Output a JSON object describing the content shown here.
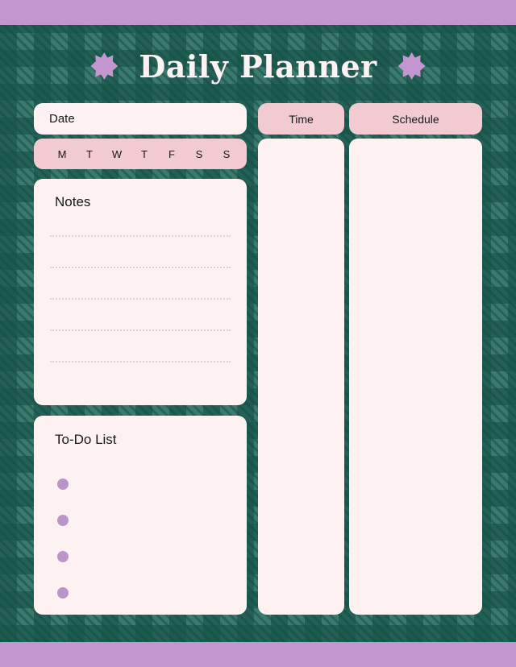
{
  "theme": {
    "accent_purple": "#c396cf",
    "plaid_green": "#3c7a6e",
    "plaid_green_dark": "#236155",
    "card_cream": "#fdf1f2",
    "pink": "#f2cbd2",
    "bullet_purple": "#bb95c9",
    "dotted_line": "#e9cdd3"
  },
  "header": {
    "title": "Daily Planner",
    "star_left": "eight-point-star",
    "star_right": "eight-point-star"
  },
  "left_column": {
    "date": {
      "label": "Date",
      "value": ""
    },
    "weekdays": [
      "M",
      "T",
      "W",
      "T",
      "F",
      "S",
      "S"
    ],
    "notes": {
      "title": "Notes",
      "line_count": 5,
      "lines": [
        "",
        "",
        "",
        "",
        ""
      ]
    },
    "todo": {
      "title": "To-Do List",
      "item_count": 4,
      "items": [
        "",
        "",
        "",
        ""
      ]
    }
  },
  "right_columns": {
    "time": {
      "header": "Time",
      "body": ""
    },
    "schedule": {
      "header": "Schedule",
      "body": ""
    }
  }
}
